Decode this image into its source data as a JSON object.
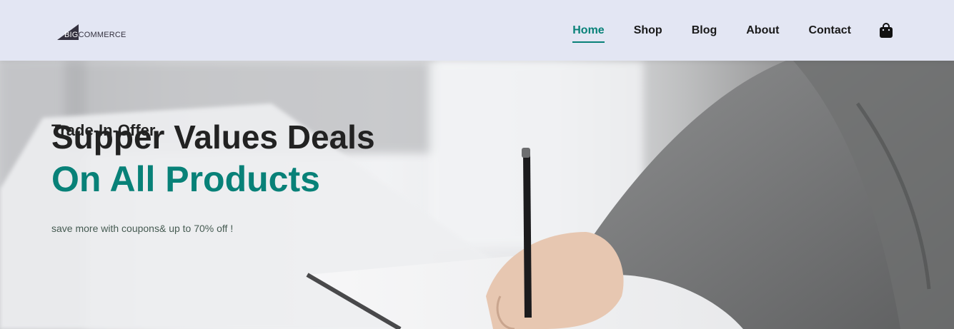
{
  "brand": {
    "logo_part1": "BIG",
    "logo_part2": "COMMERCE"
  },
  "nav": {
    "items": [
      {
        "label": "Home",
        "active": true
      },
      {
        "label": "Shop",
        "active": false
      },
      {
        "label": "Blog",
        "active": false
      },
      {
        "label": "About",
        "active": false
      },
      {
        "label": "Contact",
        "active": false
      }
    ],
    "cart_icon": "shopping-bag-icon"
  },
  "hero": {
    "kicker": "Trade-In-Offer",
    "title": "Supper Values Deals",
    "subtitle": "On All Products",
    "note": "save more with coupons& up to 70% off !",
    "image": "person-writing-in-notebook-photo"
  },
  "colors": {
    "accent": "#088178",
    "header_bg": "#e3e6f3",
    "text_dark": "#222222",
    "note_text": "#465b52"
  }
}
